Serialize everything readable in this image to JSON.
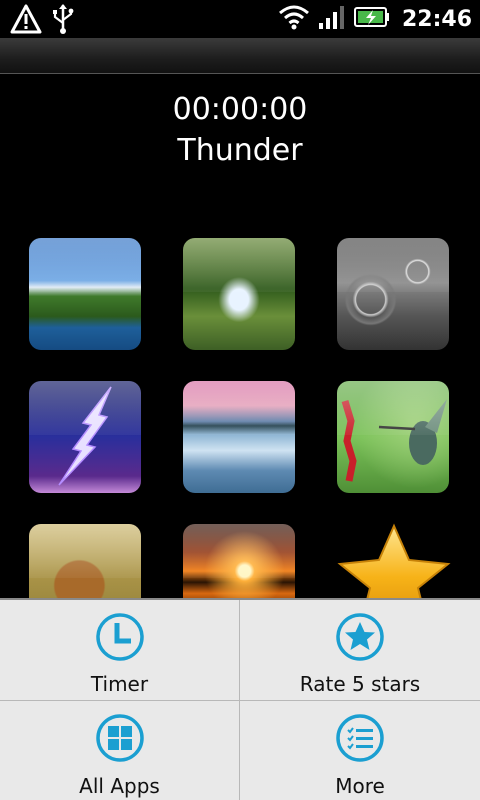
{
  "status_bar": {
    "time": "22:46",
    "icons": [
      "warning-icon",
      "usb-icon",
      "wifi-icon",
      "signal-icon",
      "battery-charging-icon"
    ]
  },
  "player": {
    "timer": "00:00:00",
    "sound": "Thunder"
  },
  "sounds": [
    "coast",
    "waterfall",
    "rain",
    "lightning",
    "niagara",
    "hummingbird",
    "lion",
    "sunset",
    "favorite-star"
  ],
  "menu": {
    "items": [
      {
        "label": "Timer",
        "icon": "clock-icon"
      },
      {
        "label": "Rate 5 stars",
        "icon": "star-circle-icon"
      },
      {
        "label": "All Apps",
        "icon": "grid-icon"
      },
      {
        "label": "More",
        "icon": "list-icon"
      }
    ]
  },
  "colors": {
    "accent": "#1b9fd1",
    "menu_bg": "#e9e9e9",
    "star": "#f7b318"
  }
}
